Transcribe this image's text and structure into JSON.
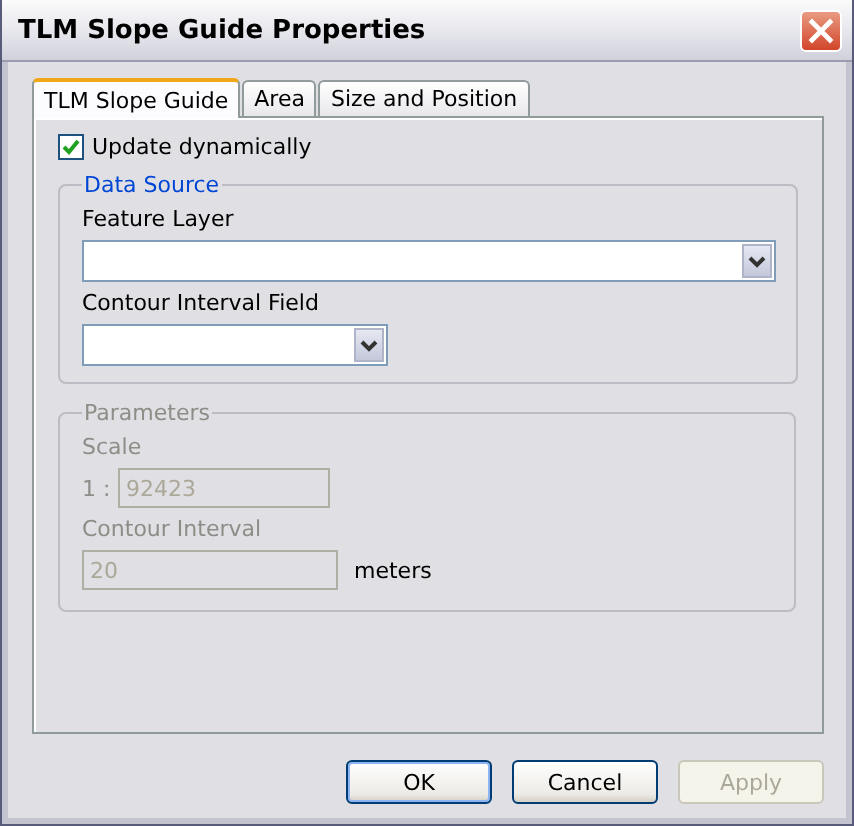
{
  "window": {
    "title": "TLM Slope Guide Properties"
  },
  "tabs": [
    {
      "label": "TLM Slope Guide",
      "selected": true
    },
    {
      "label": "Area",
      "selected": false
    },
    {
      "label": "Size and Position",
      "selected": false
    }
  ],
  "update_dynamically": {
    "label": "Update dynamically",
    "checked": true
  },
  "data_source": {
    "title": "Data Source",
    "feature_layer": {
      "label": "Feature Layer"
    },
    "contour_interval_field": {
      "label": "Contour Interval Field"
    }
  },
  "parameters": {
    "title": "Parameters",
    "disabled": true,
    "scale": {
      "label": "Scale",
      "prefix": "1 :",
      "value": "92423"
    },
    "contour_interval": {
      "label": "Contour Interval",
      "value": "20",
      "unit": "meters"
    }
  },
  "buttons": [
    {
      "label": "OK",
      "disabled": false,
      "default": true
    },
    {
      "label": "Cancel",
      "disabled": false,
      "default": false
    },
    {
      "label": "Apply",
      "disabled": true,
      "default": false
    }
  ]
}
